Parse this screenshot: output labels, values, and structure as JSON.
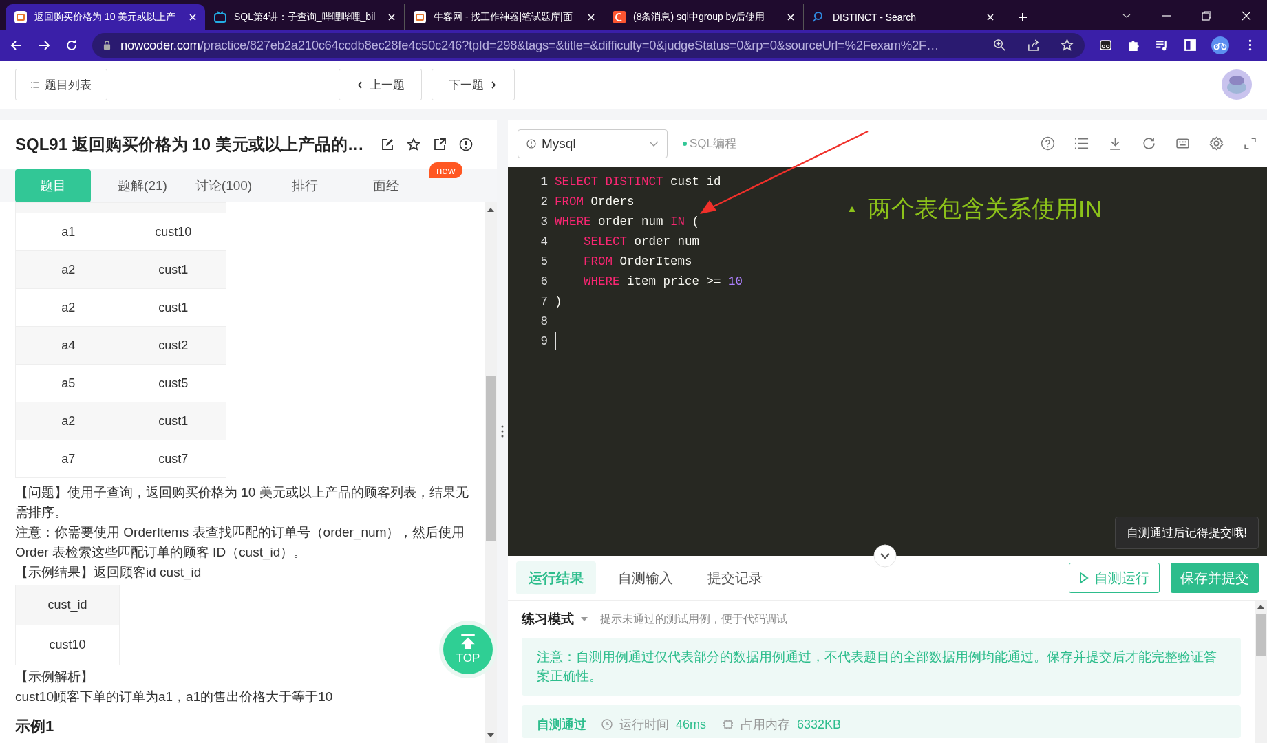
{
  "browser": {
    "tabs": [
      {
        "title": "返回购买价格为 10 美元或以上产",
        "kind": "nowcoder",
        "selected": true
      },
      {
        "title": "SQL第4讲：子查询_哔哩哔哩_bil",
        "kind": "video",
        "selected": false
      },
      {
        "title": "牛客网 - 找工作神器|笔试题库|面",
        "kind": "nowcoder",
        "selected": false
      },
      {
        "title": "(8条消息) sql中group by后使用",
        "kind": "blog",
        "selected": false
      },
      {
        "title": "DISTINCT - Search",
        "kind": "search",
        "selected": false
      }
    ],
    "address": {
      "host": "nowcoder.com",
      "path": "/practice/827eb2a210c64ccdb8ec28fe4c50c246?tpId=298&tags=&title=&difficulty=0&judgeStatus=0&rp=0&sourceUrl=%2Fexam%2F…"
    }
  },
  "header": {
    "list_button": "题目列表",
    "prev_button": "上一题",
    "next_button": "下一题"
  },
  "problem": {
    "title": "SQL91  返回购买价格为 10 美元或以上产品的…",
    "tabs": [
      {
        "label": "题目",
        "selected": true
      },
      {
        "label": "题解(21)",
        "selected": false
      },
      {
        "label": "讨论(100)",
        "selected": false
      },
      {
        "label": "排行",
        "selected": false
      },
      {
        "label": "面经",
        "selected": false,
        "badge": "new"
      }
    ],
    "table_rows": [
      [
        "a1",
        "cust10"
      ],
      [
        "a2",
        "cust1"
      ],
      [
        "a2",
        "cust1"
      ],
      [
        "a4",
        "cust2"
      ],
      [
        "a5",
        "cust5"
      ],
      [
        "a2",
        "cust1"
      ],
      [
        "a7",
        "cust7"
      ]
    ],
    "paragraphs": [
      "【问题】使用子查询，返回购买价格为 10 美元或以上产品的顾客列表，结果无需排序。",
      "注意：你需要使用 OrderItems 表查找匹配的订单号（order_num），然后使用Order 表检索这些匹配订单的顾客 ID（cust_id）。",
      "【示例结果】返回顾客id cust_id"
    ],
    "result_table": {
      "header": "cust_id",
      "rows": [
        "cust10"
      ]
    },
    "analysis_title": "【示例解析】",
    "analysis": "cust10顾客下单的订单为a1，a1的售出价格大于等于10",
    "example_heading": "示例1",
    "top_button": "TOP"
  },
  "editor": {
    "language": "Mysql",
    "tag": "SQL编程",
    "lines": [
      {
        "num": "1",
        "cursor": false,
        "tokens": [
          {
            "text": "SELECT DISTINCT",
            "kind": "keyword"
          },
          {
            "text": " cust_id",
            "kind": "plain"
          }
        ]
      },
      {
        "num": "2",
        "cursor": false,
        "tokens": [
          {
            "text": "FROM",
            "kind": "keyword"
          },
          {
            "text": " Orders",
            "kind": "plain"
          }
        ]
      },
      {
        "num": "3",
        "cursor": false,
        "tokens": [
          {
            "text": "WHERE",
            "kind": "keyword"
          },
          {
            "text": " order_num ",
            "kind": "plain"
          },
          {
            "text": "IN",
            "kind": "keyword"
          },
          {
            "text": " (",
            "kind": "plain"
          }
        ]
      },
      {
        "num": "4",
        "cursor": false,
        "tokens": [
          {
            "text": "    SELECT",
            "kind": "keyword"
          },
          {
            "text": " order_num",
            "kind": "plain"
          }
        ]
      },
      {
        "num": "5",
        "cursor": false,
        "tokens": [
          {
            "text": "    FROM",
            "kind": "keyword"
          },
          {
            "text": " OrderItems",
            "kind": "plain"
          }
        ]
      },
      {
        "num": "6",
        "cursor": false,
        "tokens": [
          {
            "text": "    WHERE",
            "kind": "keyword"
          },
          {
            "text": " item_price >= ",
            "kind": "plain"
          },
          {
            "text": "10",
            "kind": "number"
          }
        ]
      },
      {
        "num": "7",
        "cursor": false,
        "tokens": [
          {
            "text": ")",
            "kind": "plain"
          }
        ]
      },
      {
        "num": "8",
        "cursor": false
      },
      {
        "num": "9",
        "cursor": true
      }
    ],
    "annotation": "两个表包含关系使用IN",
    "tooltip": "自测通过后记得提交哦!"
  },
  "results": {
    "tabs": [
      {
        "label": "运行结果",
        "selected": true
      },
      {
        "label": "自测输入",
        "selected": false
      },
      {
        "label": "提交记录",
        "selected": false
      }
    ],
    "run_button": "自测运行",
    "submit_button": "保存并提交",
    "mode": "练习模式",
    "mode_hint": "提示未通过的测试用例，便于代码调试",
    "notice": "注意：自测用例通过仅代表部分的数据用例通过，不代表题目的全部数据用例均能通过。保存并提交后才能完整验证答案正确性。",
    "status": "自测通过",
    "time_label": "运行时间",
    "time": "46ms",
    "memory_label": "占用内存",
    "memory": "6332KB"
  }
}
